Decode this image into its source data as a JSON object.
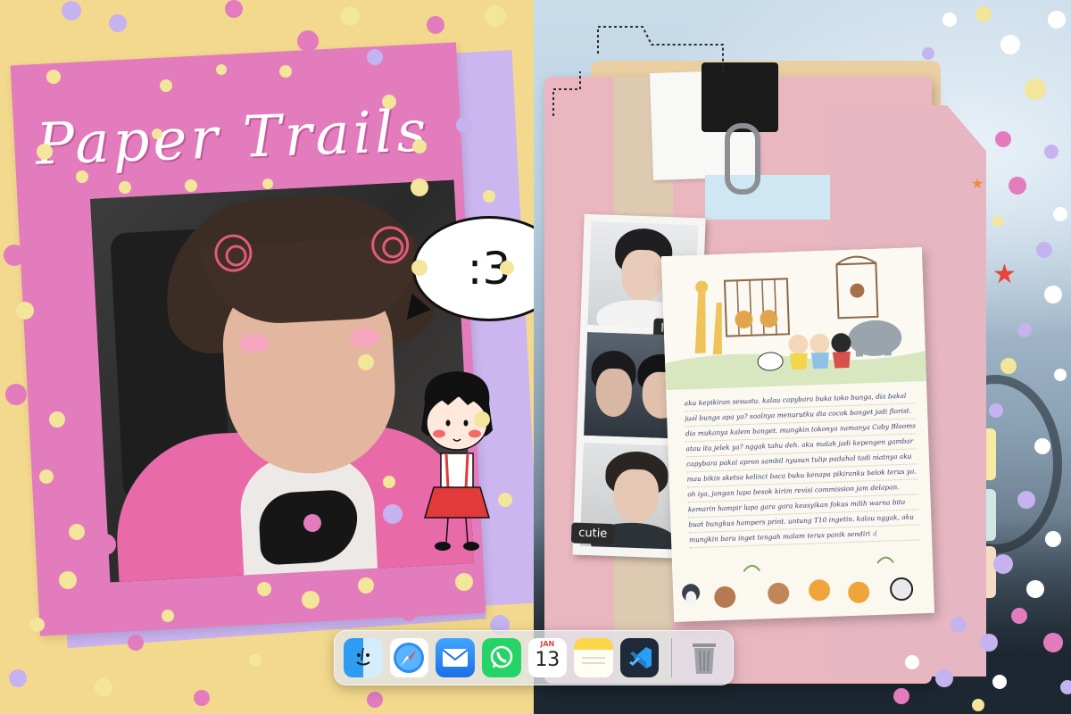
{
  "collage": {
    "title": "Paper Trails",
    "speech_bubble": ":3",
    "photo_tags": [
      "love",
      "cutie"
    ],
    "letter_lines": [
      "aku kepikiran sesuatu. kalau capybara buka toko bunga, dia bakal",
      "jual bunga apa ya? soalnya menurutku dia cocok banget jadi florist.",
      "dia mukanya kalem banget. mungkin tokonya namanya Caby Blooms",
      "atau itu jelek ya? nggak tahu deh. aku malah jadi kepengen gambar",
      "capybara pakai apron sambil nyusun tulip padahal tadi niatnya aku",
      "mau bikin sketsa kelinci baca buku kenapa pikiranku belok terus ya..",
      "oh iya, jangan lupa besok kirim revisi commission jam delapan.",
      "kemarin hampir lupa gara gara keasyikan fokus milih warna bita",
      "buat bungkus hampers print. untung T10 ingetin. kalau nggak, aku",
      "mungkin baru inget tengah malam terus panik sendiri :("
    ]
  },
  "dock": {
    "apps": [
      {
        "name": "Finder",
        "icon": "finder-icon"
      },
      {
        "name": "Safari",
        "icon": "safari-icon"
      },
      {
        "name": "Mail",
        "icon": "mail-icon"
      },
      {
        "name": "WhatsApp",
        "icon": "whatsapp-icon"
      },
      {
        "name": "Calendar",
        "icon": "calendar-icon"
      },
      {
        "name": "Notes",
        "icon": "notes-icon"
      },
      {
        "name": "Visual Studio Code",
        "icon": "vscode-icon"
      },
      {
        "name": "Trash",
        "icon": "trash-icon"
      }
    ],
    "calendar_month": "JAN",
    "calendar_day": "13"
  },
  "colors": {
    "background_yellow": "#f3d98e",
    "frame_pink": "#e27cbd",
    "paper_lilac": "#cbb6ef",
    "folder_pink": "#eab7c1",
    "letter_ink": "#2f3b77"
  }
}
